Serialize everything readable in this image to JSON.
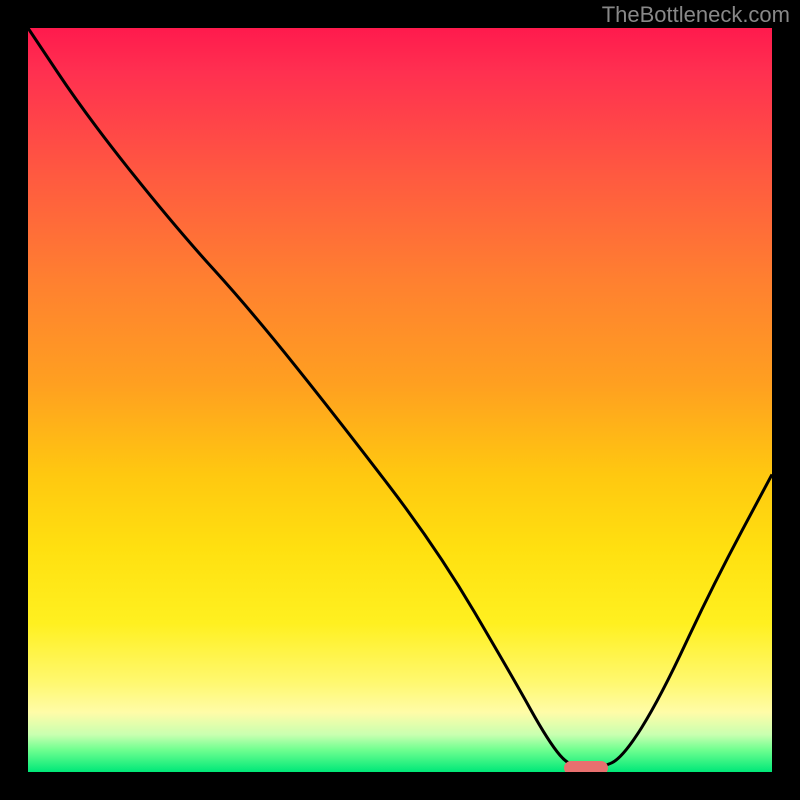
{
  "watermark": "TheBottleneck.com",
  "chart_data": {
    "type": "line",
    "title": "",
    "xlabel": "",
    "ylabel": "",
    "xlim": [
      0,
      100
    ],
    "ylim": [
      0,
      100
    ],
    "series": [
      {
        "name": "curve",
        "x": [
          0,
          8,
          20,
          30,
          42,
          55,
          65,
          70,
          73,
          77,
          80,
          85,
          92,
          100
        ],
        "y": [
          100,
          88,
          73,
          62,
          47,
          30,
          13,
          4,
          0.5,
          0.5,
          2,
          10,
          25,
          40
        ]
      }
    ],
    "marker": {
      "x": 75,
      "y": 0.5
    },
    "gradient_stops": [
      {
        "pos": 0,
        "color": "#ff1a4d"
      },
      {
        "pos": 20,
        "color": "#ff5a40"
      },
      {
        "pos": 48,
        "color": "#ffa020"
      },
      {
        "pos": 80,
        "color": "#fff020"
      },
      {
        "pos": 95,
        "color": "#c8ffb0"
      },
      {
        "pos": 100,
        "color": "#00e878"
      }
    ]
  }
}
